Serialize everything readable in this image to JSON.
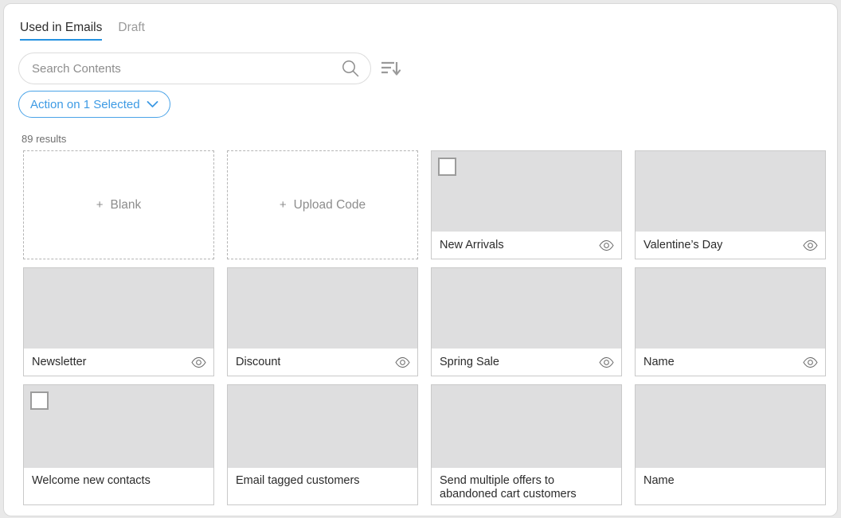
{
  "tabs": [
    {
      "label": "Used in Emails",
      "active": true
    },
    {
      "label": "Draft",
      "active": false
    }
  ],
  "search": {
    "placeholder": "Search Contents",
    "value": "",
    "icon": "search-icon"
  },
  "sort": {
    "icon": "sort-descending-icon"
  },
  "action_button": {
    "label": "Action on 1 Selected",
    "chevron": "chevron-down-icon",
    "accent_color": "#3d9ae4"
  },
  "results": {
    "count_label": "89 results"
  },
  "colors": {
    "accent": "#2491e0",
    "thumbnail": "#dededf",
    "border": "#c9c9c9",
    "muted_text": "#8d8d8d"
  },
  "cards": [
    {
      "type": "placeholder",
      "label": "Blank",
      "plus": "+"
    },
    {
      "type": "placeholder",
      "label": "Upload Code",
      "plus": "+"
    },
    {
      "type": "tile",
      "title": "New Arrivals",
      "checkbox": true,
      "checked": false,
      "eye": true,
      "tall": false
    },
    {
      "type": "tile",
      "title": "Valentine’s Day",
      "checkbox": false,
      "checked": false,
      "eye": true,
      "tall": false
    },
    {
      "type": "tile",
      "title": "Newsletter",
      "checkbox": false,
      "checked": false,
      "eye": true,
      "tall": false
    },
    {
      "type": "tile",
      "title": "Discount",
      "checkbox": false,
      "checked": false,
      "eye": true,
      "tall": false
    },
    {
      "type": "tile",
      "title": "Spring Sale",
      "checkbox": false,
      "checked": false,
      "eye": true,
      "tall": false
    },
    {
      "type": "tile",
      "title": "Name",
      "checkbox": false,
      "checked": false,
      "eye": true,
      "tall": false
    },
    {
      "type": "tile",
      "title": "Welcome new contacts",
      "checkbox": true,
      "checked": false,
      "eye": false,
      "tall": true
    },
    {
      "type": "tile",
      "title": "Email tagged customers",
      "checkbox": false,
      "checked": false,
      "eye": false,
      "tall": true
    },
    {
      "type": "tile",
      "title": "Send multiple offers to\nabandoned cart customers",
      "checkbox": false,
      "checked": false,
      "eye": false,
      "tall": true
    },
    {
      "type": "tile",
      "title": "Name",
      "checkbox": false,
      "checked": false,
      "eye": false,
      "tall": true
    }
  ]
}
